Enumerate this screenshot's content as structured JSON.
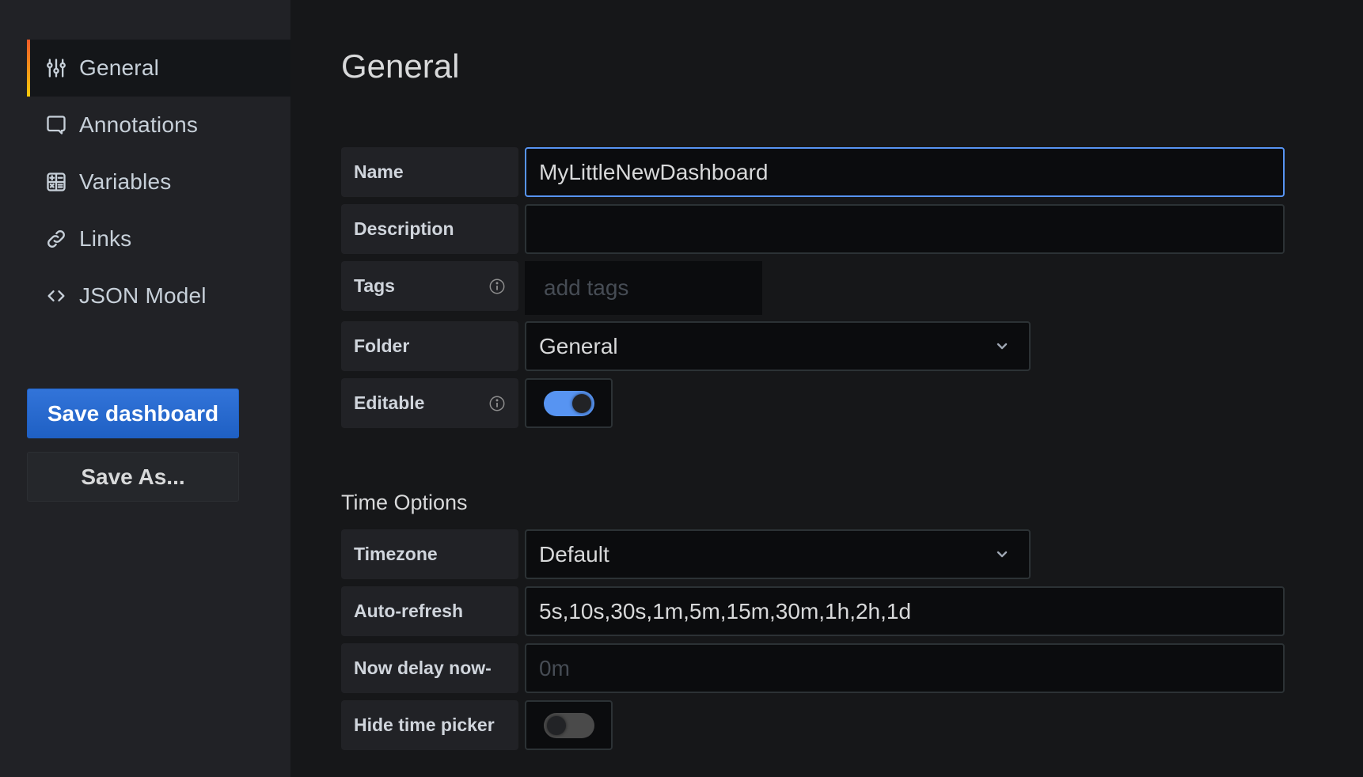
{
  "sidebar": {
    "items": [
      {
        "label": "General",
        "icon": "sliders-icon",
        "active": true
      },
      {
        "label": "Annotations",
        "icon": "comment-icon",
        "active": false
      },
      {
        "label": "Variables",
        "icon": "calculator-icon",
        "active": false
      },
      {
        "label": "Links",
        "icon": "link-icon",
        "active": false
      },
      {
        "label": "JSON Model",
        "icon": "code-icon",
        "active": false
      }
    ],
    "save_label": "Save dashboard",
    "save_as_label": "Save As..."
  },
  "main": {
    "title": "General",
    "fields": {
      "name": {
        "label": "Name",
        "value": "MyLittleNewDashboard"
      },
      "description": {
        "label": "Description",
        "value": ""
      },
      "tags": {
        "label": "Tags",
        "placeholder": "add tags"
      },
      "folder": {
        "label": "Folder",
        "value": "General"
      },
      "editable": {
        "label": "Editable",
        "checked": true
      }
    },
    "time_options": {
      "title": "Time Options",
      "timezone": {
        "label": "Timezone",
        "value": "Default"
      },
      "auto_refresh": {
        "label": "Auto-refresh",
        "value": "5s,10s,30s,1m,5m,15m,30m,1h,2h,1d"
      },
      "now_delay": {
        "label": "Now delay now-",
        "placeholder": "0m",
        "value": ""
      },
      "hide_time_picker": {
        "label": "Hide time picker",
        "checked": false
      }
    }
  },
  "colors": {
    "accent_blue": "#5794f2",
    "primary_button": "#3274d9",
    "active_gradient_start": "#f05a28",
    "active_gradient_end": "#fbca0a"
  }
}
